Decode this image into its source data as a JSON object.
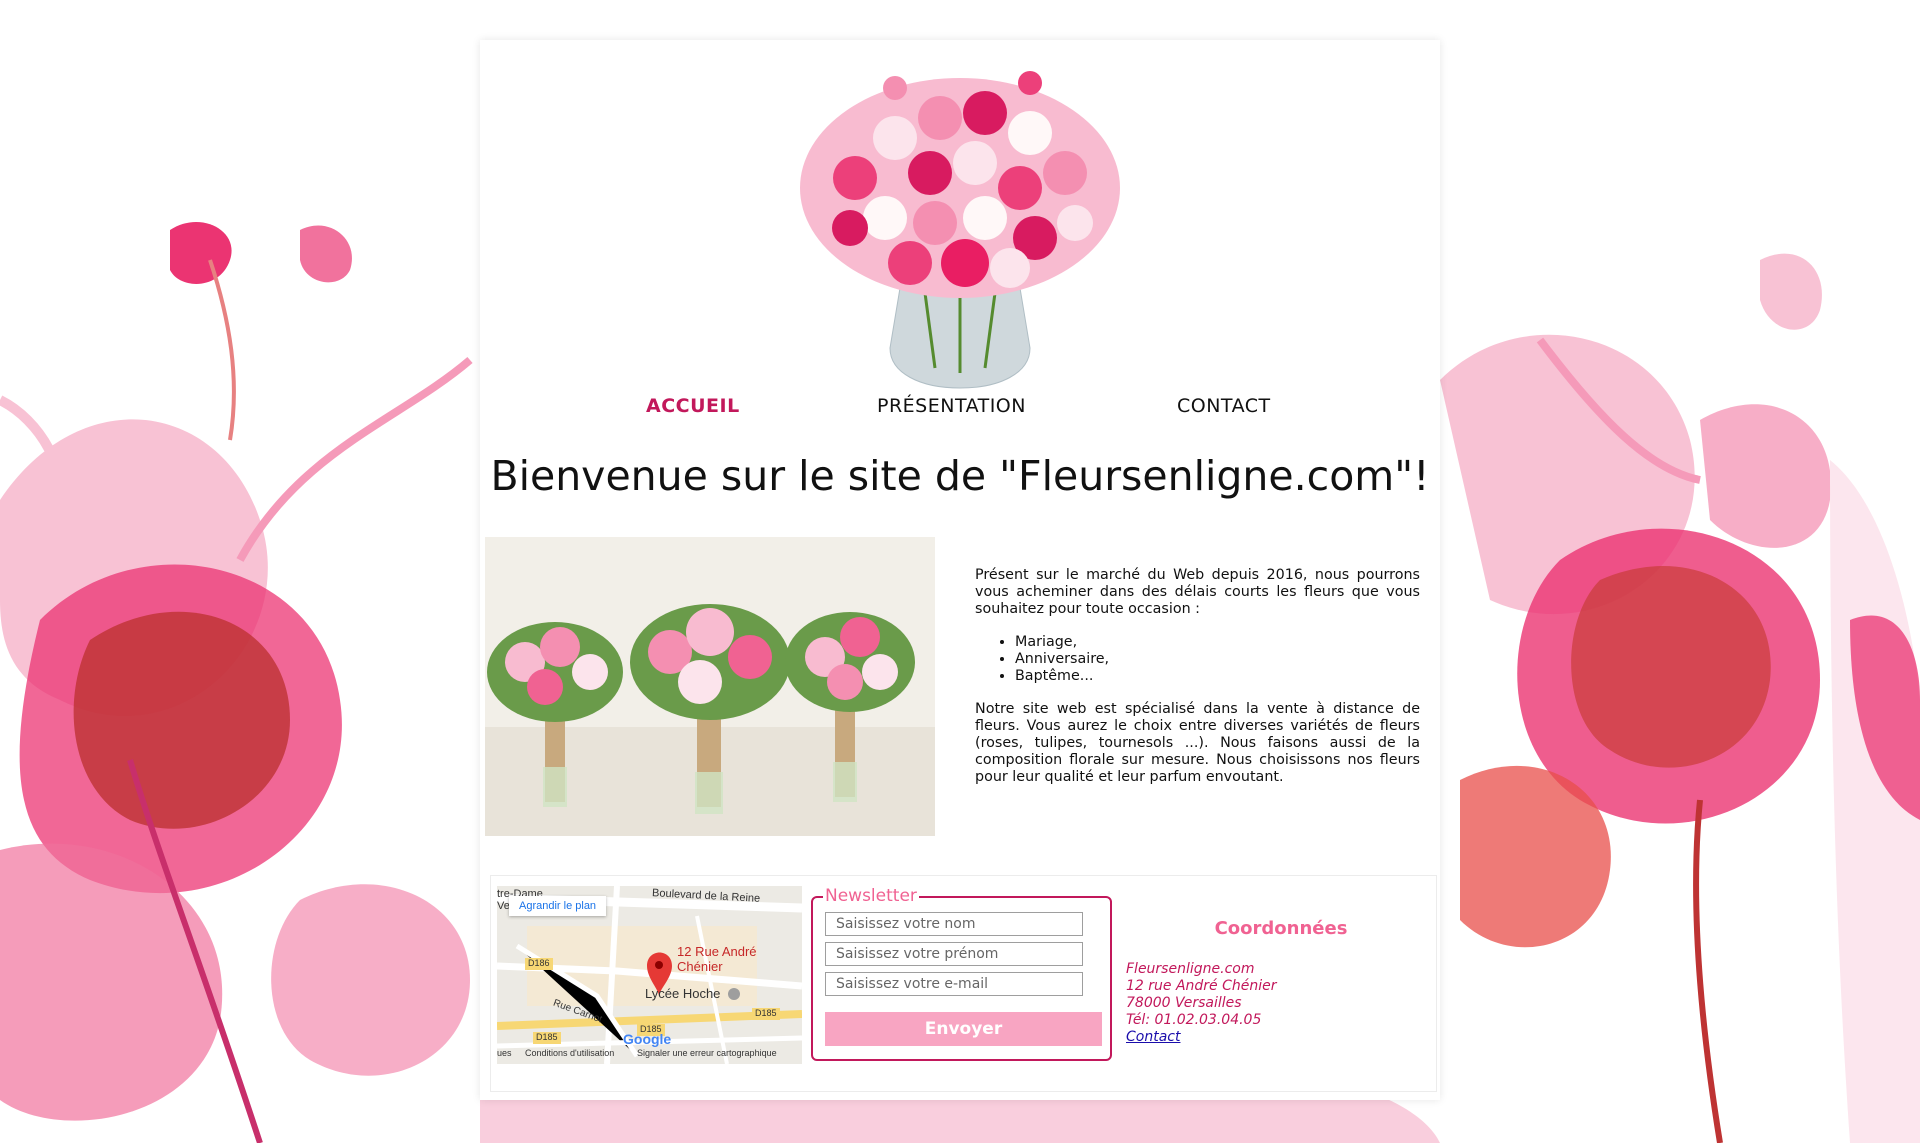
{
  "nav": {
    "items": [
      {
        "label": "ACCUEIL",
        "active": true
      },
      {
        "label": "PRÉSENTATION",
        "active": false
      },
      {
        "label": "CONTACT",
        "active": false
      }
    ]
  },
  "main": {
    "title": "Bienvenue sur le site de \"Fleursenligne.com\"!",
    "intro_paragraph": "Présent sur le marché du Web depuis 2016, nous pourrons vous acheminer dans des délais courts les fleurs que vous souhaitez pour toute occasion :",
    "occasions": [
      "Mariage,",
      "Anniversaire,",
      "Baptême..."
    ],
    "second_paragraph": "Notre site web est spécialisé dans la vente à distance de fleurs. Vous aurez le choix entre diverses variétés de fleurs (roses, tulipes, tournesols ...). Nous faisons aussi de la composition florale sur mesure. Nous choisissons nos fleurs pour leur qualité et leur parfum envoutant."
  },
  "map": {
    "enlarge_label": "Agrandir le plan",
    "marker_label": "12 Rue André Chénier",
    "poi_label": "Lycée Hoche",
    "street_boulevard": "Boulevard de la Reine",
    "street_notre_dame": "tre-Dame",
    "street_carnot": "Rue Carnot",
    "road_d186": "D186",
    "road_d185": "D185",
    "logo": "Google",
    "terms_label": "Conditions d'utilisation",
    "report_label": "Signaler une erreur cartographique",
    "edge_left": "ues",
    "edge_top": "Ve"
  },
  "newsletter": {
    "legend": "Newsletter",
    "name_placeholder": "Saisissez votre nom",
    "firstname_placeholder": "Saisissez votre prénom",
    "email_placeholder": "Saisissez votre e-mail",
    "submit_label": "Envoyer"
  },
  "coordinates": {
    "title": "Coordonnées",
    "site": "Fleursenligne.com",
    "street": "12 rue André Chénier",
    "city": "78000 Versailles",
    "phone": "Tél: 01.02.03.04.05",
    "contact_link": "Contact"
  },
  "colors": {
    "accent": "#c2185b",
    "pink": "#f06292",
    "button": "#f8a5c2"
  }
}
